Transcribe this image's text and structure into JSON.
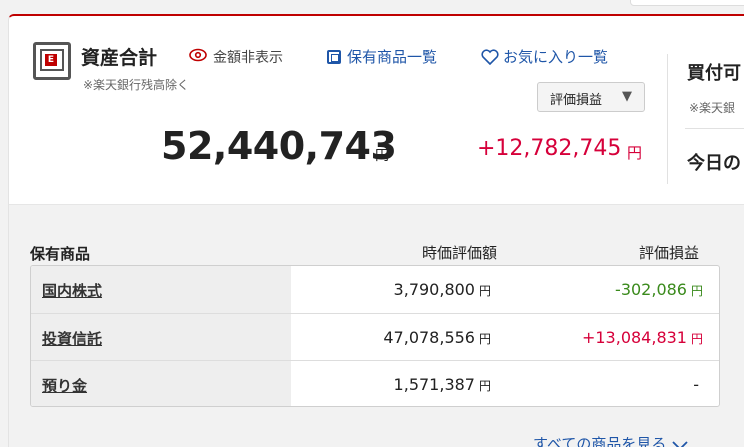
{
  "summary": {
    "title": "資産合計",
    "hide_amount_label": "金額非表示",
    "note": "※楽天銀行残高除く",
    "holdings_link": "保有商品一覧",
    "favorites_link": "お気に入り一覧",
    "select_label": "評価損益",
    "select_arrow": "▼",
    "total": "52,440,743",
    "total_unit": "円",
    "gain": "+12,782,745",
    "gain_unit": "円"
  },
  "right_panel": {
    "title": "買付可",
    "note": "※楽天銀",
    "today": "今日の"
  },
  "table": {
    "headers": {
      "name": "保有商品",
      "value": "時価評価額",
      "gain": "評価損益"
    },
    "rows": [
      {
        "name": "国内株式",
        "value": "3,790,800",
        "value_unit": "円",
        "gain": "-302,086",
        "gain_unit": "円"
      },
      {
        "name": "投資信託",
        "value": "47,078,556",
        "value_unit": "円",
        "gain": "+13,084,831",
        "gain_unit": "円"
      },
      {
        "name": "預り金",
        "value": "1,571,387",
        "value_unit": "円",
        "gain": "-",
        "gain_unit": ""
      }
    ],
    "see_all": "すべての商品を見る"
  },
  "colors": {
    "accent": "#bf0000",
    "link": "#1f56a8",
    "positive": "#d6003a",
    "negative": "#3a8a1c"
  },
  "icons": {
    "safe": "safe-icon",
    "eye": "eye-icon",
    "list": "list-icon",
    "heart": "heart-icon",
    "chevron": "chevron-down-icon"
  }
}
